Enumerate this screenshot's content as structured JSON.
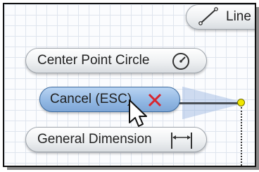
{
  "menu": {
    "line_label": "Line",
    "center_point_circle_label": "Center Point Circle",
    "cancel_label": "Cancel (ESC)",
    "general_dimension_label": "General Dimension"
  },
  "icons": {
    "line": "line-tool-icon",
    "center_point_circle": "circle-icon",
    "cancel": "x-icon",
    "general_dimension": "dimension-icon",
    "cursor": "mouse-pointer-icon"
  },
  "colors": {
    "selected_fill": "#93b9e4",
    "cancel_x": "#d8262f",
    "vertex": "#f0e600"
  }
}
